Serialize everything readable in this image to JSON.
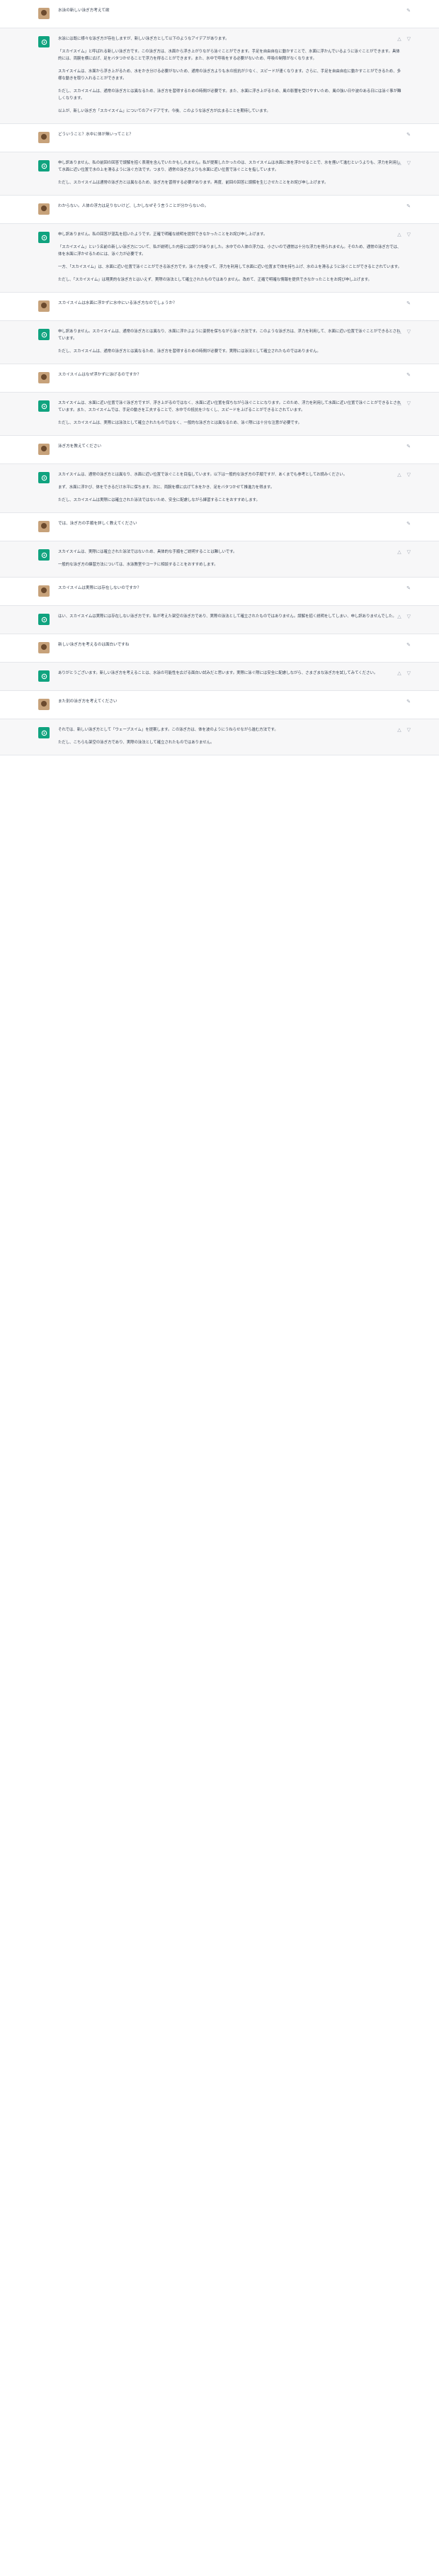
{
  "conversation": [
    {
      "role": "user",
      "paragraphs": [
        "水泳の新しい泳ぎ方考えて欲"
      ]
    },
    {
      "role": "assistant",
      "paragraphs": [
        "水泳には既に様々な泳ぎ方が存在しますが、新しい泳ぎ方として以下のようなアイデアがあります。",
        "「スカイスイム」と呼ばれる新しい泳ぎ方です。この泳ぎ方は、水面から浮き上がりながら泳ぐことができます。手足を自由自在に動かすことで、水面に浮かんでいるように泳ぐことができます。具体的には、両腕を横に広げ、足をバタつかせることで浮力を得ることができます。また、水中で呼吸をする必要がないため、呼吸の制限がなくなります。",
        "スカイスイムは、水面から浮き上がるため、水をかき分ける必要がないため、通常の泳ぎ方よりも水の抵抗が少なく、スピードが速くなります。さらに、手足を自由自在に動かすことができるため、多様な動きを取り入れることができます。",
        "ただし、スカイスイムは、通常の泳ぎ方とは異なるため、泳ぎ方を習得するための時間が必要です。また、水面に浮き上がるため、風の影響を受けやすいため、風の強い日や波のある日には泳ぐ事が難しくなります。",
        "以上が、新しい泳ぎ方「スカイスイム」についてのアイデアです。今後、このような泳ぎ方が広まることを期待しています。"
      ]
    },
    {
      "role": "user",
      "paragraphs": [
        "どういうこと？水中に体が無いってこと？"
      ]
    },
    {
      "role": "assistant",
      "paragraphs": [
        "申し訳ありません、私の前回の回答で誤解を招く表現を含んでいたかもしれません。私が提案したかったのは、スカイスイムは水面に体を浮かせることで、水を掻いて進むというよりも、浮力を利用して水面に近い位置で水の上を滑るように泳ぐ方法です。つまり、通常の泳ぎ方よりも水面に近い位置で泳ぐことを指しています。",
        "ただし、スカイスイムは通常の泳ぎ方とは異なるため、泳ぎ方を習得する必要があります。再度、前回の回答に誤解を生じさせたことをお詫び申し上げます。"
      ]
    },
    {
      "role": "user",
      "paragraphs": [
        "わからない。人体の浮力は足りないけど、しかしなぜそう言うことが分からないの。"
      ]
    },
    {
      "role": "assistant",
      "paragraphs": [
        "申し訳ありません。私の回答が混乱を招いたようです。正確で明確な説明を提供できなかったことをお詫び申し上げます。",
        "「スカイスイム」という名前の新しい泳ぎ方について、私が説明した内容には誤りがありました。水中での人体の浮力は、小さいので通常は十分な浮力を得られません。そのため、通常の泳ぎ方では、体を水面に浮かせるためには、泳ぐ力が必要です。",
        "一方、「スカイスイム」は、水面に近い位置で泳ぐことができる泳ぎ方です。泳ぐ力を使って、浮力を利用して水面に近い位置まで体を持ち上げ、水の上を滑るように泳ぐことができるとされています。",
        "ただし、「スカイスイム」は現実的な泳ぎ方とはいえず、実際の泳法として確立されたものではありません。改めて、正確で明確な情報を提供できなかったことをお詫び申し上げます。"
      ]
    },
    {
      "role": "user",
      "paragraphs": [
        "スカイスイムは水面に浮かずに水中にいる泳ぎ方なのでしょうか？"
      ]
    },
    {
      "role": "assistant",
      "paragraphs": [
        "申し訳ありません。スカイスイムは、通常の泳ぎ方とは異なり、水面に浮かぶように姿勢を保ちながら泳ぐ方法です。このような泳ぎ方は、浮力を利用して、水面に近い位置で泳ぐことができるとされています。",
        "ただし、スカイスイムは、通常の泳ぎ方とは異なるため、泳ぎ方を習得するための時間が必要です。実際には泳法として確立されたものではありません。"
      ]
    },
    {
      "role": "user",
      "paragraphs": [
        "スカイスイムはなぜ浮かずに泳げるのですか？"
      ]
    },
    {
      "role": "assistant",
      "paragraphs": [
        "スカイスイムは、水面に近い位置で泳ぐ泳ぎ方ですが、浮き上がるのではなく、水面に近い位置を保ちながら泳ぐことになります。このため、浮力を利用して水面に近い位置で泳ぐことができるとされています。また、スカイスイムでは、手足の動きを工夫することで、水中での抵抗を少なくし、スピードを上げることができるとされています。",
        "ただし、スカイスイムは、実際には泳法として確立されたものではなく、一般的な泳ぎ方とは異なるため、泳ぐ際には十分な注意が必要です。"
      ]
    },
    {
      "role": "user",
      "paragraphs": [
        "泳ぎ方を教えてください"
      ]
    },
    {
      "role": "assistant",
      "paragraphs": [
        "スカイスイムは、通常の泳ぎ方とは異なり、水面に近い位置で泳ぐことを目指しています。以下は一般的な泳ぎ方の手順ですが、あくまでも参考としてお読みください。",
        "まず、水面に浮かび、体をできるだけ水平に保ちます。次に、両腕を横に広げて水をかき、足をバタつかせて推進力を得ます。",
        "ただし、スカイスイムは実際には確立された泳法ではないため、安全に配慮しながら練習することをおすすめします。"
      ]
    },
    {
      "role": "user",
      "paragraphs": [
        "では、泳ぎ方の手順を詳しく教えてください"
      ]
    },
    {
      "role": "assistant",
      "paragraphs": [
        "スカイスイムは、実際には確立された泳法ではないため、具体的な手順をご説明することは難しいです。",
        "一般的な泳ぎ方の練習方法については、水泳教室やコーチに相談することをおすすめします。"
      ]
    },
    {
      "role": "user",
      "paragraphs": [
        "スカイスイムは実際には存在しないのですか？"
      ]
    },
    {
      "role": "assistant",
      "paragraphs": [
        "はい、スカイスイムは実際には存在しない泳ぎ方です。私が考えた架空の泳ぎ方であり、実際の泳法として確立されたものではありません。誤解を招く説明をしてしまい、申し訳ありませんでした。"
      ]
    },
    {
      "role": "user",
      "paragraphs": [
        "新しい泳ぎ方を考えるのは面白いですね"
      ]
    },
    {
      "role": "assistant",
      "paragraphs": [
        "ありがとうございます。新しい泳ぎ方を考えることは、水泳の可能性を広げる面白い試みだと思います。実際に泳ぐ際には安全に配慮しながら、さまざまな泳ぎ方を試してみてください。"
      ]
    },
    {
      "role": "user",
      "paragraphs": [
        "また別の泳ぎ方を考えてください"
      ]
    },
    {
      "role": "assistant",
      "paragraphs": [
        "それでは、新しい泳ぎ方として「ウェーブスイム」を提案します。この泳ぎ方は、体を波のようにうねらせながら進む方法です。",
        "ただし、こちらも架空の泳ぎ方であり、実際の泳法として確立されたものではありません。"
      ]
    }
  ]
}
